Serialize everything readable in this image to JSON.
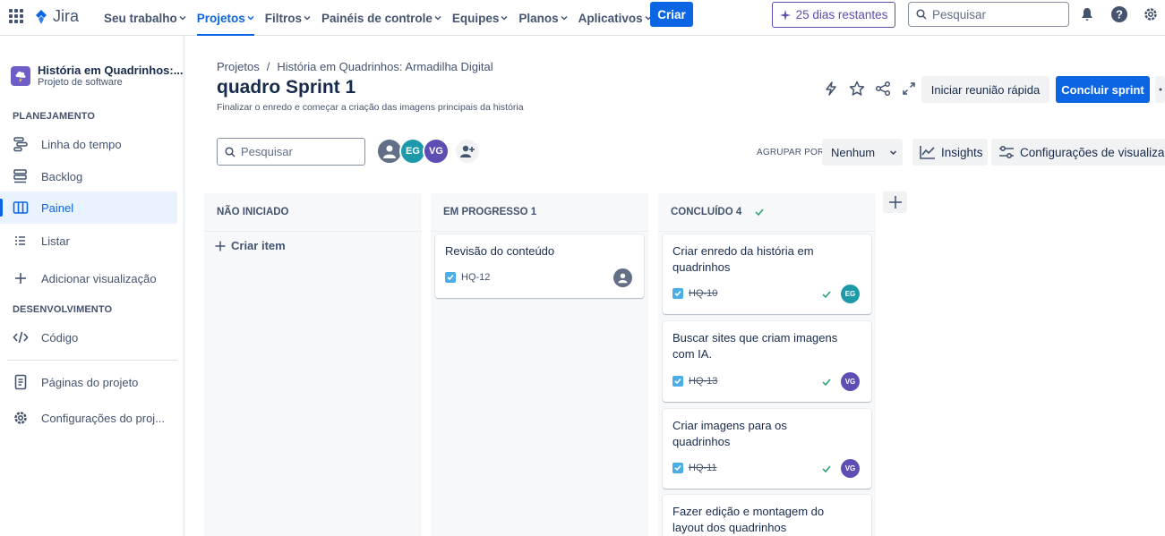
{
  "topnav": {
    "brand": "Jira",
    "items": [
      {
        "label": "Seu trabalho",
        "active": false
      },
      {
        "label": "Projetos",
        "active": true
      },
      {
        "label": "Filtros",
        "active": false
      },
      {
        "label": "Painéis de controle",
        "active": false
      },
      {
        "label": "Equipes",
        "active": false
      },
      {
        "label": "Planos",
        "active": false
      },
      {
        "label": "Aplicativos",
        "active": false
      }
    ],
    "create_label": "Criar",
    "trial_label": "25 dias restantes",
    "search_placeholder": "Pesquisar"
  },
  "sidebar": {
    "project_name": "História em Quadrinhos:...",
    "project_type": "Projeto de software",
    "planning_label": "PLANEJAMENTO",
    "items": [
      {
        "label": "Linha do tempo"
      },
      {
        "label": "Backlog"
      },
      {
        "label": "Painel",
        "active": true
      },
      {
        "label": "Listar"
      },
      {
        "label": "Adicionar visualização"
      }
    ],
    "dev_label": "DESENVOLVIMENTO",
    "code_label": "Código",
    "project_pages_label": "Páginas do projeto",
    "project_settings_label": "Configurações do proj..."
  },
  "header": {
    "breadcrumb": [
      "Projetos",
      "História em Quadrinhos: Armadilha Digital"
    ],
    "breadcrumb_sep": "/",
    "title": "quadro Sprint 1",
    "subtitle": "Finalizar o enredo e começar a criação das imagens principais da história",
    "quick_meeting_label": "Iniciar reunião rápida",
    "complete_sprint_label": "Concluir sprint"
  },
  "toolbar": {
    "search_placeholder": "Pesquisar",
    "avatars": [
      {
        "initials": "",
        "color": "#626f86"
      },
      {
        "initials": "EG",
        "color": "#1d9aaa"
      },
      {
        "initials": "VG",
        "color": "#5e4db2"
      }
    ],
    "group_by_label": "AGRUPAR POR",
    "group_by_value": "Nenhum",
    "insights_label": "Insights",
    "view_settings_label": "Configurações de visualização"
  },
  "board": {
    "columns": [
      {
        "title": "NÃO INICIADO",
        "create_label": "Criar item",
        "cards": []
      },
      {
        "title": "EM PROGRESSO 1",
        "cards": [
          {
            "title": "Revisão do conteúdo",
            "key": "HQ-12",
            "done": false,
            "assignee": ""
          }
        ]
      },
      {
        "title": "CONCLUÍDO 4",
        "cards": [
          {
            "title": "Criar enredo da história em quadrinhos",
            "key": "HQ-10",
            "done": true,
            "assignee": "EG"
          },
          {
            "title": "Buscar sites que criam imagens com IA.",
            "key": "HQ-13",
            "done": true,
            "assignee": "VG"
          },
          {
            "title": "Criar imagens para os quadrinhos",
            "key": "HQ-11",
            "done": true,
            "assignee": "VG"
          },
          {
            "title": "Fazer edição e montagem do layout dos quadrinhos",
            "key": "",
            "done": true,
            "assignee": ""
          }
        ]
      }
    ]
  },
  "colors": {
    "brand_blue": "#0c66e4",
    "trial_purple": "#5e4db2",
    "eg_teal": "#1d9aaa",
    "vg_purple": "#5e4db2",
    "done_green": "#22a06b",
    "task_blue": "#4bade8"
  }
}
